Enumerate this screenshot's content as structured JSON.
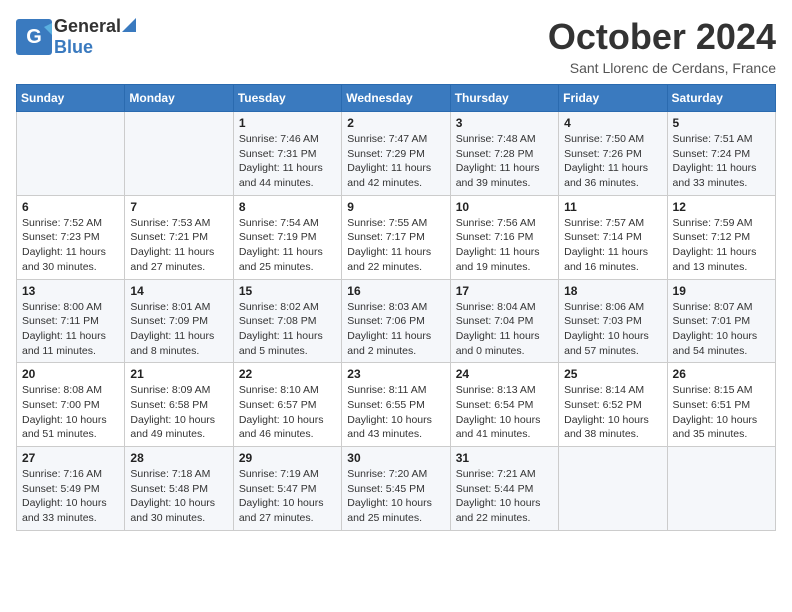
{
  "header": {
    "logo_general": "General",
    "logo_blue": "Blue",
    "month_title": "October 2024",
    "location": "Sant Llorenc de Cerdans, France"
  },
  "days_of_week": [
    "Sunday",
    "Monday",
    "Tuesday",
    "Wednesday",
    "Thursday",
    "Friday",
    "Saturday"
  ],
  "weeks": [
    [
      {
        "day": "",
        "sunrise": "",
        "sunset": "",
        "daylight": ""
      },
      {
        "day": "",
        "sunrise": "",
        "sunset": "",
        "daylight": ""
      },
      {
        "day": "1",
        "sunrise": "Sunrise: 7:46 AM",
        "sunset": "Sunset: 7:31 PM",
        "daylight": "Daylight: 11 hours and 44 minutes."
      },
      {
        "day": "2",
        "sunrise": "Sunrise: 7:47 AM",
        "sunset": "Sunset: 7:29 PM",
        "daylight": "Daylight: 11 hours and 42 minutes."
      },
      {
        "day": "3",
        "sunrise": "Sunrise: 7:48 AM",
        "sunset": "Sunset: 7:28 PM",
        "daylight": "Daylight: 11 hours and 39 minutes."
      },
      {
        "day": "4",
        "sunrise": "Sunrise: 7:50 AM",
        "sunset": "Sunset: 7:26 PM",
        "daylight": "Daylight: 11 hours and 36 minutes."
      },
      {
        "day": "5",
        "sunrise": "Sunrise: 7:51 AM",
        "sunset": "Sunset: 7:24 PM",
        "daylight": "Daylight: 11 hours and 33 minutes."
      }
    ],
    [
      {
        "day": "6",
        "sunrise": "Sunrise: 7:52 AM",
        "sunset": "Sunset: 7:23 PM",
        "daylight": "Daylight: 11 hours and 30 minutes."
      },
      {
        "day": "7",
        "sunrise": "Sunrise: 7:53 AM",
        "sunset": "Sunset: 7:21 PM",
        "daylight": "Daylight: 11 hours and 27 minutes."
      },
      {
        "day": "8",
        "sunrise": "Sunrise: 7:54 AM",
        "sunset": "Sunset: 7:19 PM",
        "daylight": "Daylight: 11 hours and 25 minutes."
      },
      {
        "day": "9",
        "sunrise": "Sunrise: 7:55 AM",
        "sunset": "Sunset: 7:17 PM",
        "daylight": "Daylight: 11 hours and 22 minutes."
      },
      {
        "day": "10",
        "sunrise": "Sunrise: 7:56 AM",
        "sunset": "Sunset: 7:16 PM",
        "daylight": "Daylight: 11 hours and 19 minutes."
      },
      {
        "day": "11",
        "sunrise": "Sunrise: 7:57 AM",
        "sunset": "Sunset: 7:14 PM",
        "daylight": "Daylight: 11 hours and 16 minutes."
      },
      {
        "day": "12",
        "sunrise": "Sunrise: 7:59 AM",
        "sunset": "Sunset: 7:12 PM",
        "daylight": "Daylight: 11 hours and 13 minutes."
      }
    ],
    [
      {
        "day": "13",
        "sunrise": "Sunrise: 8:00 AM",
        "sunset": "Sunset: 7:11 PM",
        "daylight": "Daylight: 11 hours and 11 minutes."
      },
      {
        "day": "14",
        "sunrise": "Sunrise: 8:01 AM",
        "sunset": "Sunset: 7:09 PM",
        "daylight": "Daylight: 11 hours and 8 minutes."
      },
      {
        "day": "15",
        "sunrise": "Sunrise: 8:02 AM",
        "sunset": "Sunset: 7:08 PM",
        "daylight": "Daylight: 11 hours and 5 minutes."
      },
      {
        "day": "16",
        "sunrise": "Sunrise: 8:03 AM",
        "sunset": "Sunset: 7:06 PM",
        "daylight": "Daylight: 11 hours and 2 minutes."
      },
      {
        "day": "17",
        "sunrise": "Sunrise: 8:04 AM",
        "sunset": "Sunset: 7:04 PM",
        "daylight": "Daylight: 11 hours and 0 minutes."
      },
      {
        "day": "18",
        "sunrise": "Sunrise: 8:06 AM",
        "sunset": "Sunset: 7:03 PM",
        "daylight": "Daylight: 10 hours and 57 minutes."
      },
      {
        "day": "19",
        "sunrise": "Sunrise: 8:07 AM",
        "sunset": "Sunset: 7:01 PM",
        "daylight": "Daylight: 10 hours and 54 minutes."
      }
    ],
    [
      {
        "day": "20",
        "sunrise": "Sunrise: 8:08 AM",
        "sunset": "Sunset: 7:00 PM",
        "daylight": "Daylight: 10 hours and 51 minutes."
      },
      {
        "day": "21",
        "sunrise": "Sunrise: 8:09 AM",
        "sunset": "Sunset: 6:58 PM",
        "daylight": "Daylight: 10 hours and 49 minutes."
      },
      {
        "day": "22",
        "sunrise": "Sunrise: 8:10 AM",
        "sunset": "Sunset: 6:57 PM",
        "daylight": "Daylight: 10 hours and 46 minutes."
      },
      {
        "day": "23",
        "sunrise": "Sunrise: 8:11 AM",
        "sunset": "Sunset: 6:55 PM",
        "daylight": "Daylight: 10 hours and 43 minutes."
      },
      {
        "day": "24",
        "sunrise": "Sunrise: 8:13 AM",
        "sunset": "Sunset: 6:54 PM",
        "daylight": "Daylight: 10 hours and 41 minutes."
      },
      {
        "day": "25",
        "sunrise": "Sunrise: 8:14 AM",
        "sunset": "Sunset: 6:52 PM",
        "daylight": "Daylight: 10 hours and 38 minutes."
      },
      {
        "day": "26",
        "sunrise": "Sunrise: 8:15 AM",
        "sunset": "Sunset: 6:51 PM",
        "daylight": "Daylight: 10 hours and 35 minutes."
      }
    ],
    [
      {
        "day": "27",
        "sunrise": "Sunrise: 7:16 AM",
        "sunset": "Sunset: 5:49 PM",
        "daylight": "Daylight: 10 hours and 33 minutes."
      },
      {
        "day": "28",
        "sunrise": "Sunrise: 7:18 AM",
        "sunset": "Sunset: 5:48 PM",
        "daylight": "Daylight: 10 hours and 30 minutes."
      },
      {
        "day": "29",
        "sunrise": "Sunrise: 7:19 AM",
        "sunset": "Sunset: 5:47 PM",
        "daylight": "Daylight: 10 hours and 27 minutes."
      },
      {
        "day": "30",
        "sunrise": "Sunrise: 7:20 AM",
        "sunset": "Sunset: 5:45 PM",
        "daylight": "Daylight: 10 hours and 25 minutes."
      },
      {
        "day": "31",
        "sunrise": "Sunrise: 7:21 AM",
        "sunset": "Sunset: 5:44 PM",
        "daylight": "Daylight: 10 hours and 22 minutes."
      },
      {
        "day": "",
        "sunrise": "",
        "sunset": "",
        "daylight": ""
      },
      {
        "day": "",
        "sunrise": "",
        "sunset": "",
        "daylight": ""
      }
    ]
  ]
}
